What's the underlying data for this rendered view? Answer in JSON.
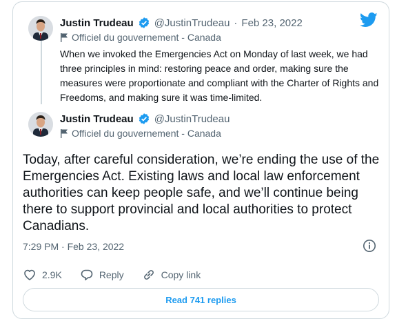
{
  "quoted_tweet": {
    "name": "Justin Trudeau",
    "handle": "@JustinTrudeau",
    "date_separator": "·",
    "date": "Feb 23, 2022",
    "label": "Officiel du gouvernement - Canada",
    "text": "When we invoked the Emergencies Act on Monday of last week, we had three principles in mind: restoring peace and order, making sure the measures were proportionate and compliant with the Charter of Rights and Freedoms, and making sure it was time-limited."
  },
  "main_tweet": {
    "name": "Justin Trudeau",
    "handle": "@JustinTrudeau",
    "label": "Officiel du gouvernement - Canada",
    "text": "Today, after careful consideration, we’re ending the use of the Emergencies Act. Existing laws and local law enforcement authorities can keep people safe, and we’ll continue being there to support provincial and local authorities to protect Canadians.",
    "timestamp": "7:29 PM · Feb 23, 2022"
  },
  "actions": {
    "like_count": "2.9K",
    "reply_label": "Reply",
    "copy_label": "Copy link"
  },
  "read_replies_label": "Read 741 replies",
  "colors": {
    "accent": "#1d9bf0",
    "secondary_text": "#536471",
    "border": "#cfd9de"
  },
  "icons": [
    "twitter-bird-icon",
    "verified-badge-icon",
    "flag-icon",
    "info-icon",
    "heart-icon",
    "reply-icon",
    "link-icon"
  ]
}
